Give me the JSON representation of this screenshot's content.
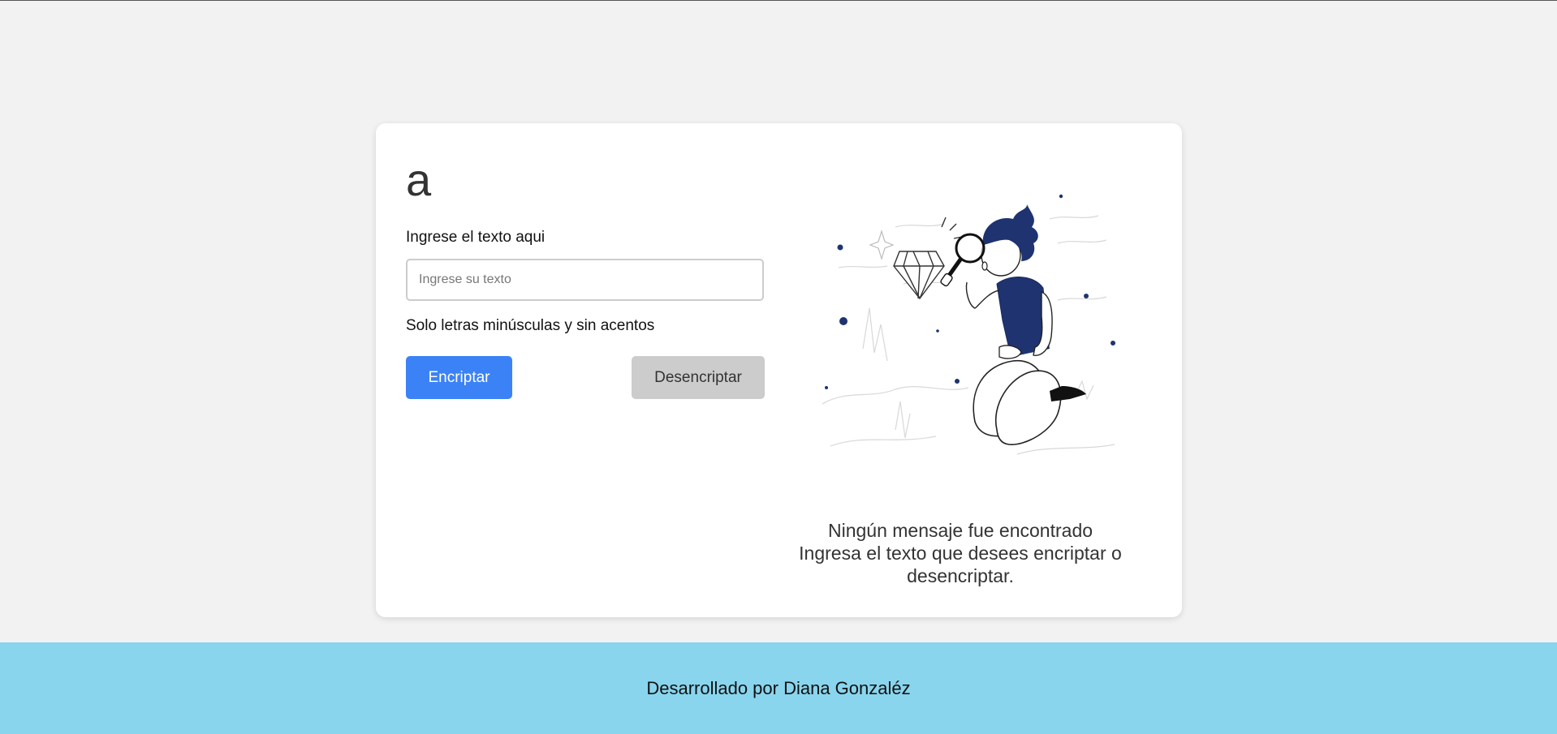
{
  "app": {
    "logo_text": "a"
  },
  "form": {
    "label": "Ingrese el texto aqui",
    "input_placeholder": "Ingrese su texto",
    "input_value": "",
    "hint": "Solo letras minúsculas y sin acentos",
    "encrypt_label": "Encriptar",
    "decrypt_label": "Desencriptar"
  },
  "output": {
    "illustration_icon": "person-with-magnifier-and-diamond",
    "title": "Ningún mensaje fue encontrado",
    "subtitle": "Ingresa el texto que desees encriptar o desencriptar."
  },
  "footer": {
    "text": "Desarrollado por Diana Gonzaléz"
  },
  "colors": {
    "background": "#f2f2f2",
    "card": "#ffffff",
    "encrypt_button": "#3b82f6",
    "decrypt_button": "#cccccc",
    "footer": "#89d5ee",
    "illustration_accent": "#1e3370"
  }
}
